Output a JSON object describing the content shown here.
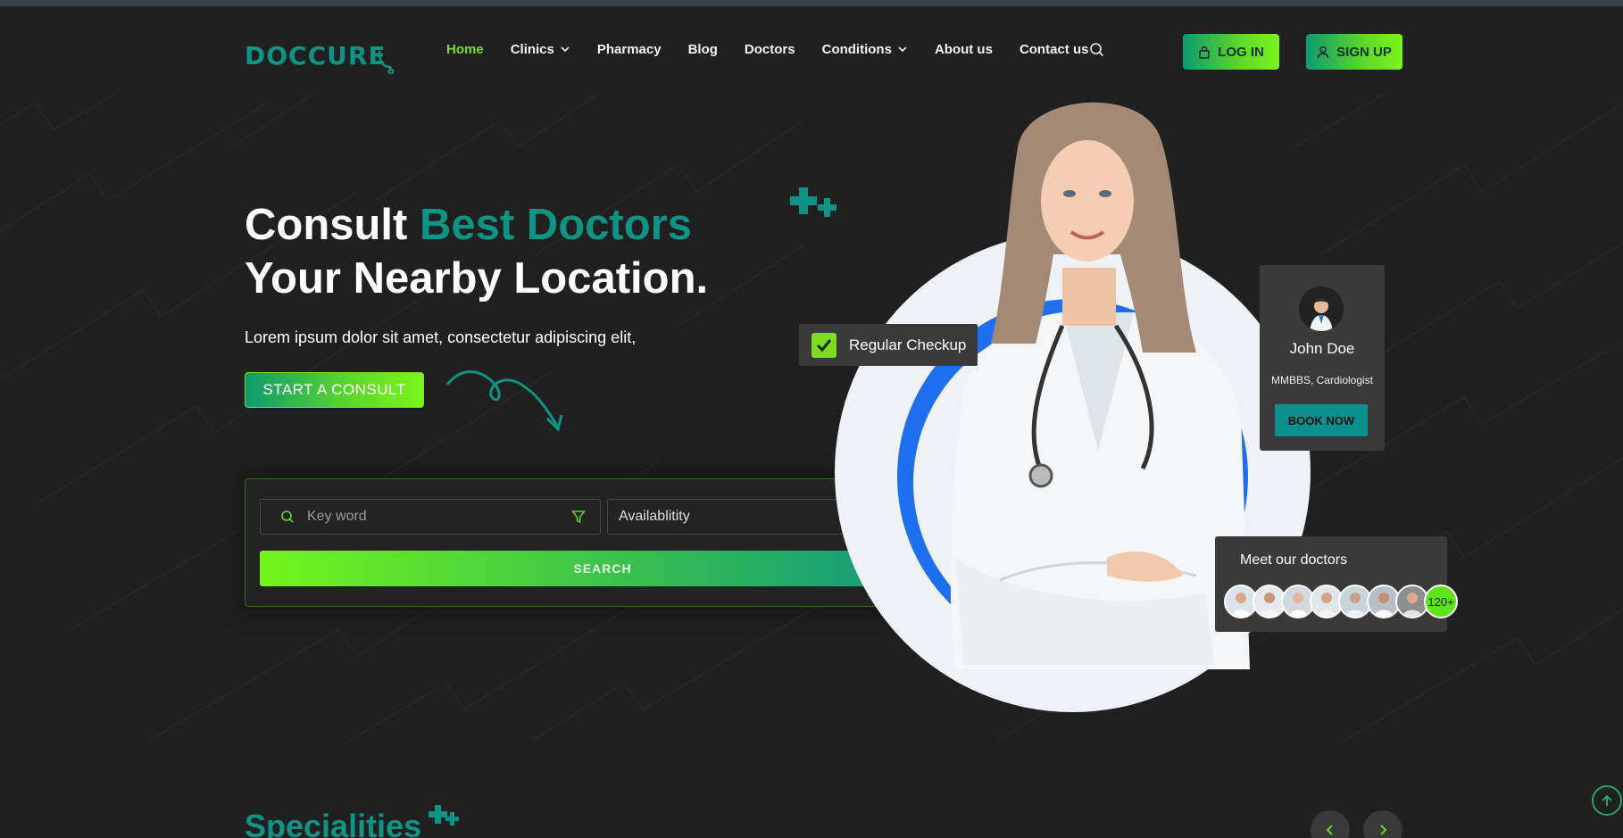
{
  "header": {
    "logo_text": "DOCCURE",
    "nav": [
      {
        "label": "Home",
        "active": true
      },
      {
        "label": "Clinics",
        "dropdown": true
      },
      {
        "label": "Pharmacy"
      },
      {
        "label": "Blog"
      },
      {
        "label": "Doctors"
      },
      {
        "label": "Conditions",
        "dropdown": true
      },
      {
        "label": "About us"
      },
      {
        "label": "Contact us"
      }
    ],
    "login_label": "LOG IN",
    "signup_label": "SIGN UP"
  },
  "hero": {
    "title_part1": "Consult ",
    "title_highlight": "Best Doctors",
    "title_part2": " Your Nearby Location.",
    "subtitle": "Lorem ipsum dolor sit amet, consectetur adipiscing elit,",
    "cta_label": "START A CONSULT"
  },
  "search": {
    "keyword_placeholder": "Key word",
    "availability_value": "Availablitity",
    "button_label": "SEARCH"
  },
  "checkup_card": {
    "label": "Regular Checkup"
  },
  "doctor_card": {
    "name": "John Doe",
    "role": "MMBBS, Cardiologist",
    "button_label": "BOOK NOW"
  },
  "meet_card": {
    "title": "Meet our doctors",
    "more_count": "120+"
  },
  "specialities": {
    "title": "Specialities"
  },
  "colors": {
    "accent_teal": "#0e9384",
    "accent_green": "#7ddc1f",
    "background": "#202020",
    "blue_ring": "#1e6ff0"
  }
}
